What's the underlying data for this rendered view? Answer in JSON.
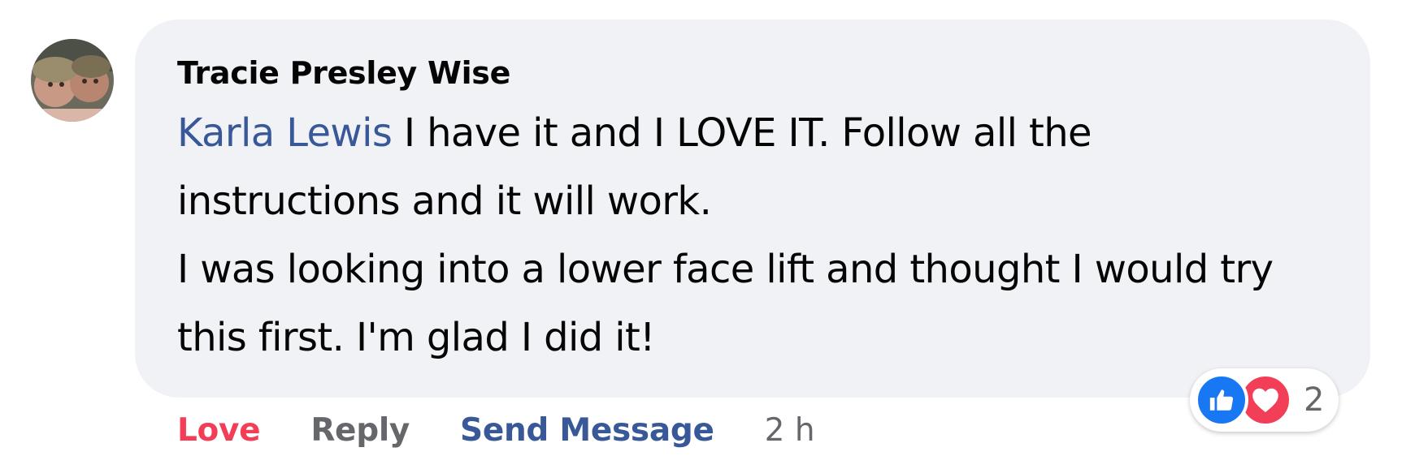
{
  "comment": {
    "author": "Tracie Presley Wise",
    "mention": "Karla Lewis",
    "body_line1": " I have it and I LOVE IT. Follow all the instructions and it will work.",
    "body_line2": "I was looking into a lower face lift and thought I would try this first. I'm glad I did it!"
  },
  "actions": {
    "love_label": "Love",
    "reply_label": "Reply",
    "send_message_label": "Send Message",
    "timestamp": "2 h"
  },
  "reactions": {
    "icons": [
      "like-icon",
      "heart-icon"
    ],
    "count": "2"
  },
  "colors": {
    "bubble_bg": "#f0f2f5",
    "love_red": "#f33e58",
    "link_blue": "#385898",
    "like_blue": "#1877f2",
    "meta_gray": "#65676b"
  }
}
